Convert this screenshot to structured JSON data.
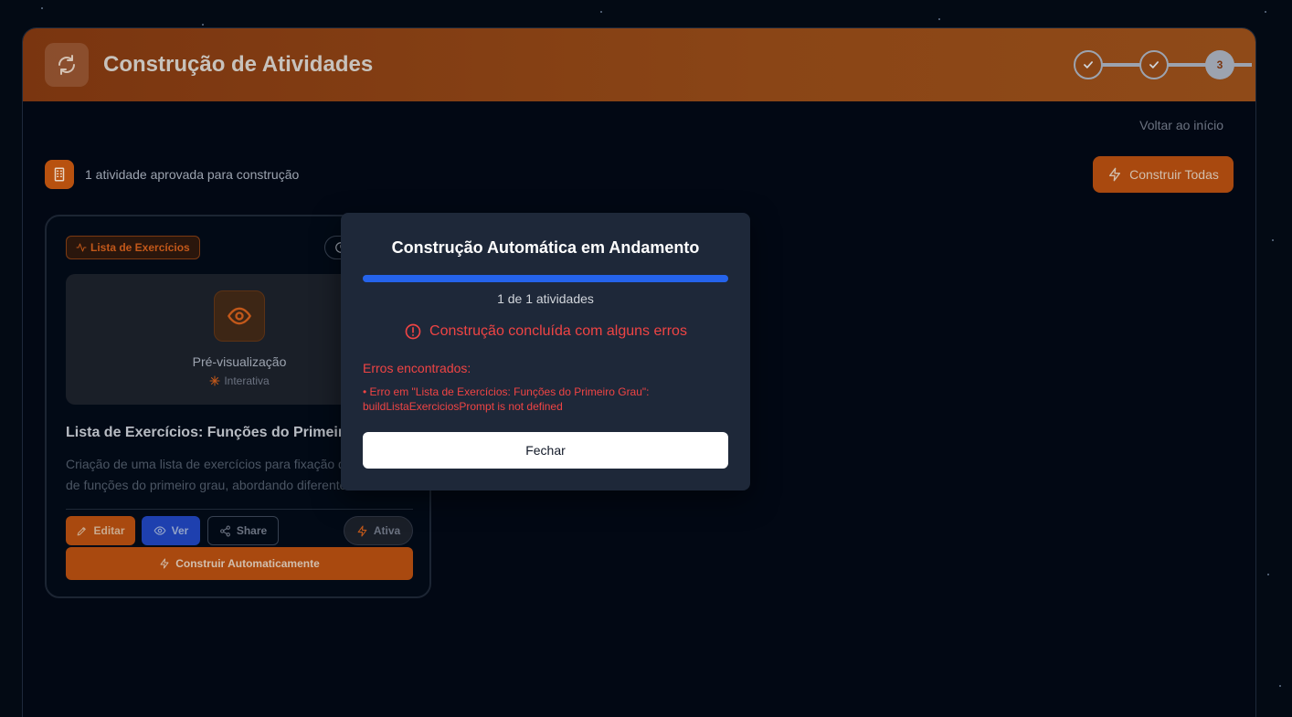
{
  "header": {
    "title": "Construção de Atividades",
    "icon": "refresh-icon",
    "accent": "#8a4516",
    "steps": [
      {
        "label": "",
        "state": "done"
      },
      {
        "label": "",
        "state": "done"
      },
      {
        "label": "3",
        "state": "current"
      }
    ]
  },
  "nav": {
    "back_label": "Voltar ao início"
  },
  "summary": {
    "approved_text": "1 atividade aprovada para construção",
    "build_all_label": "Construir Todas"
  },
  "card": {
    "tag_label": "Lista de Exercícios",
    "preview_title": "Pré-visualização",
    "preview_sub": "Interativa",
    "title": "Lista de Exercícios: Funções do Primeiro Grau",
    "description": "Criação de uma lista de exercícios para fixação dos conceitos de funções do primeiro grau, abordando diferentes níveis",
    "buttons": {
      "edit": "Editar",
      "view": "Ver",
      "share": "Share",
      "active": "Ativa"
    },
    "build_auto_label": "Construir Automaticamente"
  },
  "modal": {
    "title": "Construção Automática em Andamento",
    "progress_percent": 100,
    "progress_text": "1 de 1 atividades",
    "status_text": "Construção concluída com alguns erros",
    "errors_label": "Erros encontrados:",
    "error_message": "• Erro em \"Lista de Exercícios: Funções do Primeiro Grau\": buildListaExerciciosPrompt is not defined",
    "close_label": "Fechar",
    "error_color": "#ef4444",
    "progress_color": "#2563eb"
  }
}
